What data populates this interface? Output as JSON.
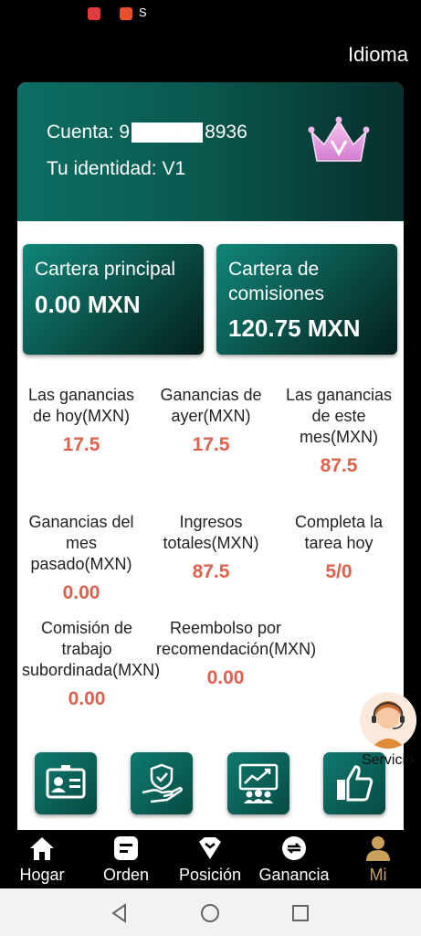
{
  "status_bar": {
    "text": "S"
  },
  "top": {
    "language": "Idioma"
  },
  "profile": {
    "account_prefix": "Cuenta: 9",
    "account_suffix": "8936",
    "identity": "Tu identidad: V1"
  },
  "wallets": [
    {
      "title": "Cartera principal",
      "value": "0.00 MXN"
    },
    {
      "title": "Cartera de comisiones",
      "value": "120.75 MXN"
    }
  ],
  "stats": [
    {
      "label": "Las ganancias de hoy(MXN)",
      "value": "17.5"
    },
    {
      "label": "Ganancias de ayer(MXN)",
      "value": "17.5"
    },
    {
      "label": "Las ganancias de este mes(MXN)",
      "value": "87.5"
    },
    {
      "label": "Ganancias del mes pasado(MXN)",
      "value": "0.00"
    },
    {
      "label": "Ingresos totales(MXN)",
      "value": "87.5"
    },
    {
      "label": "Completa la tarea hoy",
      "value": "5/0"
    },
    {
      "label": "Comisión de trabajo subordinada(MXN)",
      "value": "0.00"
    },
    {
      "label": "Reembolso por recomendación(MXN)",
      "value": "0.00"
    }
  ],
  "shortcuts": [
    "id-card-icon",
    "secure-hand-icon",
    "team-growth-icon",
    "thumbs-up-icon"
  ],
  "service": {
    "label": "Servicio"
  },
  "tabs": [
    {
      "label": "Hogar",
      "icon": "home-icon"
    },
    {
      "label": "Orden",
      "icon": "order-icon"
    },
    {
      "label": "Posición",
      "icon": "position-icon"
    },
    {
      "label": "Ganancia",
      "icon": "earnings-icon"
    },
    {
      "label": "Mi",
      "icon": "user-icon",
      "active": true
    }
  ],
  "colors": {
    "accent": "#0d6e63",
    "value_red": "#e0604e",
    "active_tab": "#c9a15a"
  }
}
